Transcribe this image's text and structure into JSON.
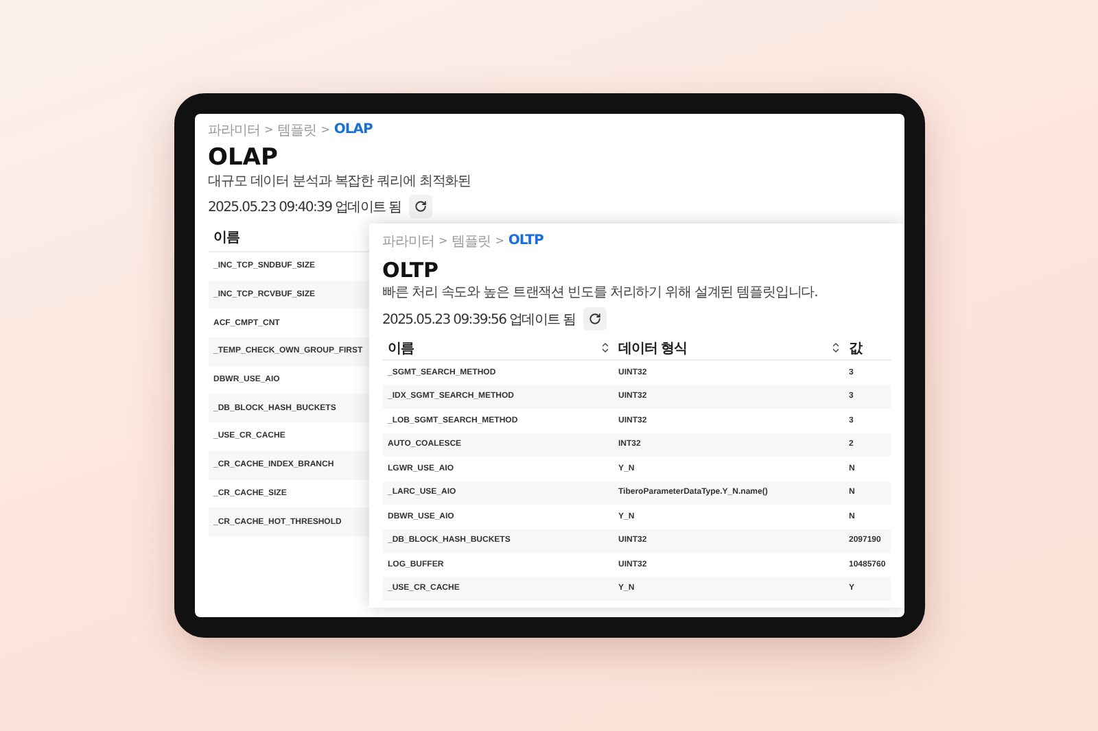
{
  "back_panel": {
    "breadcrumb": {
      "separator": ">",
      "items": [
        {
          "label": "파라미터",
          "current": false
        },
        {
          "label": "템플릿",
          "current": false
        },
        {
          "label": "OLAP",
          "current": true
        }
      ]
    },
    "title": "OLAP",
    "description": "대규모 데이터 분석과 복잡한 쿼리에 최적화된",
    "updated": "2025.05.23 09:40:39 업데이트 됨",
    "table": {
      "columns": [
        "이름"
      ],
      "rows": [
        [
          "_INC_TCP_SNDBUF_SIZE"
        ],
        [
          "_INC_TCP_RCVBUF_SIZE"
        ],
        [
          "ACF_CMPT_CNT"
        ],
        [
          "_TEMP_CHECK_OWN_GROUP_FIRST"
        ],
        [
          "DBWR_USE_AIO"
        ],
        [
          "_DB_BLOCK_HASH_BUCKETS"
        ],
        [
          "_USE_CR_CACHE"
        ],
        [
          "_CR_CACHE_INDEX_BRANCH"
        ],
        [
          "_CR_CACHE_SIZE"
        ],
        [
          "_CR_CACHE_HOT_THRESHOLD"
        ]
      ]
    }
  },
  "front_panel": {
    "breadcrumb": {
      "separator": ">",
      "items": [
        {
          "label": "파라미터",
          "current": false
        },
        {
          "label": "템플릿",
          "current": false
        },
        {
          "label": "OLTP",
          "current": true
        }
      ]
    },
    "title": "OLTP",
    "description": "빠른 처리 속도와 높은 트랜잭션 빈도를 처리하기 위해 설계된 템플릿입니다.",
    "updated": "2025.05.23 09:39:56 업데이트 됨",
    "table": {
      "columns": [
        {
          "label": "이름",
          "sortable": true
        },
        {
          "label": "데이터 형식",
          "sortable": true
        },
        {
          "label": "값",
          "sortable": false
        }
      ],
      "rows": [
        [
          "_SGMT_SEARCH_METHOD",
          "UINT32",
          "3"
        ],
        [
          "_IDX_SGMT_SEARCH_METHOD",
          "UINT32",
          "3"
        ],
        [
          "_LOB_SGMT_SEARCH_METHOD",
          "UINT32",
          "3"
        ],
        [
          "AUTO_COALESCE",
          "INT32",
          "2"
        ],
        [
          "LGWR_USE_AIO",
          "Y_N",
          "N"
        ],
        [
          "_LARC_USE_AIO",
          "TiberoParameterDataType.Y_N.name()",
          "N"
        ],
        [
          "DBWR_USE_AIO",
          "Y_N",
          "N"
        ],
        [
          "_DB_BLOCK_HASH_BUCKETS",
          "UINT32",
          "2097190"
        ],
        [
          "LOG_BUFFER",
          "UINT32",
          "10485760"
        ],
        [
          "_USE_CR_CACHE",
          "Y_N",
          "Y"
        ]
      ]
    }
  }
}
